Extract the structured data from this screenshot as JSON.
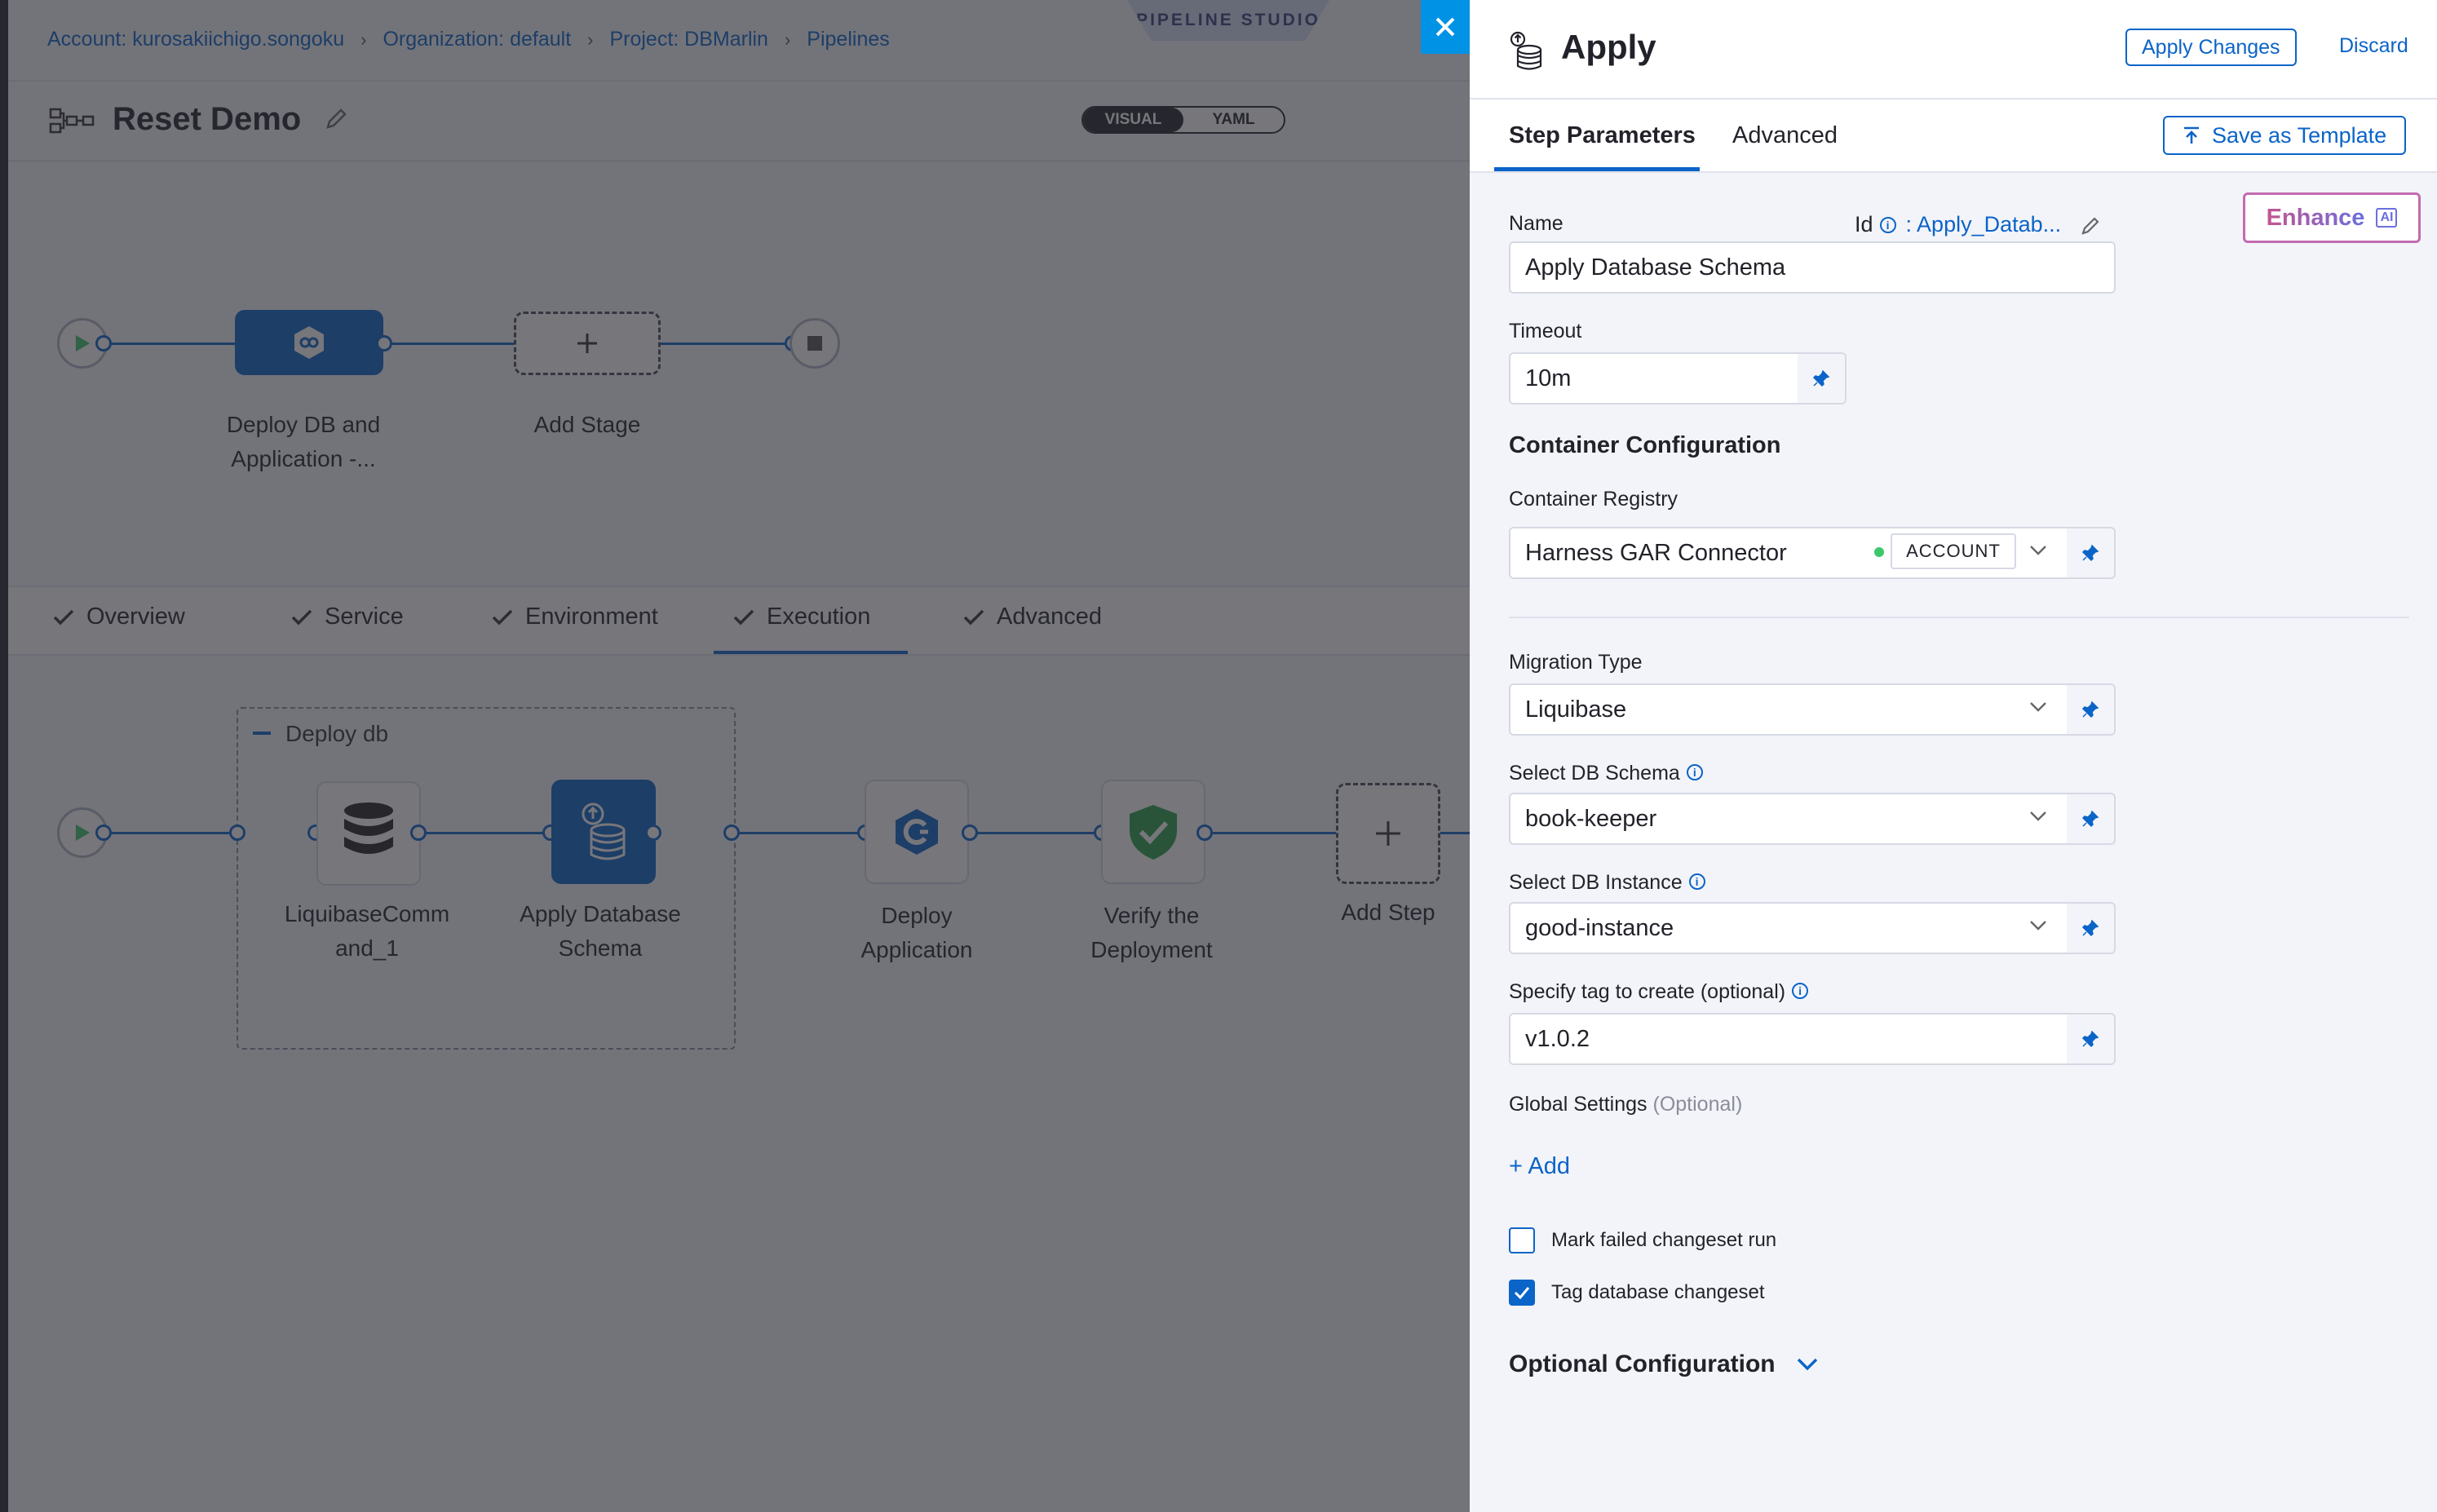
{
  "breadcrumb": {
    "account": "Account: kurosakiichigo.songoku",
    "organization": "Organization: default",
    "project": "Project: DBMarlin",
    "pipelines": "Pipelines",
    "separator": "›"
  },
  "studio_label": "PIPELINE STUDIO",
  "pipeline": {
    "name": "Reset Demo",
    "view_visual": "VISUAL",
    "view_yaml": "YAML",
    "stages": [
      {
        "label_line1": "Deploy DB and",
        "label_line2": "Application -..."
      },
      {
        "label_line1": "Add Stage",
        "label_line2": ""
      }
    ]
  },
  "stage_tabs": [
    {
      "label": "Overview"
    },
    {
      "label": "Service"
    },
    {
      "label": "Environment"
    },
    {
      "label": "Execution"
    },
    {
      "label": "Advanced"
    }
  ],
  "execution": {
    "group_title": "Deploy db",
    "steps": [
      {
        "line1": "LiquibaseComm",
        "line2": "and_1"
      },
      {
        "line1": "Apply Database",
        "line2": "Schema"
      },
      {
        "line1": "Deploy",
        "line2": "Application"
      },
      {
        "line1": "Verify the",
        "line2": "Deployment"
      },
      {
        "line1": "Add Step",
        "line2": ""
      }
    ]
  },
  "panel": {
    "title": "Apply",
    "apply_changes": "Apply Changes",
    "discard": "Discard",
    "tabs": {
      "step_parameters": "Step Parameters",
      "advanced": "Advanced"
    },
    "save_as_template": "Save as Template",
    "enhance": "Enhance",
    "ai_badge": "AI",
    "name_label": "Name",
    "name_value": "Apply Database Schema",
    "id_label": "Id",
    "id_value": ": Apply_Datab...",
    "timeout_label": "Timeout",
    "timeout_value": "10m",
    "container_config_title": "Container Configuration",
    "container_registry_label": "Container Registry",
    "container_registry_value": "Harness GAR Connector",
    "container_registry_scope": "ACCOUNT",
    "migration_type_label": "Migration Type",
    "migration_type_value": "Liquibase",
    "db_schema_label": "Select DB Schema",
    "db_schema_value": "book-keeper",
    "db_instance_label": "Select DB Instance",
    "db_instance_value": "good-instance",
    "tag_label": "Specify tag to create (optional)",
    "tag_value": "v1.0.2",
    "global_settings_label": "Global Settings",
    "global_settings_optional": "(Optional)",
    "add_label": "+ Add",
    "mark_failed_label": "Mark failed changeset run",
    "mark_failed_checked": false,
    "tag_changeset_label": "Tag database changeset",
    "tag_changeset_checked": true,
    "optional_config_label": "Optional Configuration"
  },
  "colors": {
    "accent": "#0b64c8",
    "close_button": "#0092e4",
    "status_green": "#3dc76b",
    "step_active": "#0b64c8"
  },
  "icons": [
    "pipeline-icon",
    "edit-icon",
    "play-icon",
    "stop-icon",
    "plus-icon",
    "database-icon",
    "check-icon",
    "shield-check-icon",
    "deploy-icon",
    "close-icon",
    "upload-icon",
    "info-icon",
    "pin-icon",
    "chevron-down-icon"
  ]
}
